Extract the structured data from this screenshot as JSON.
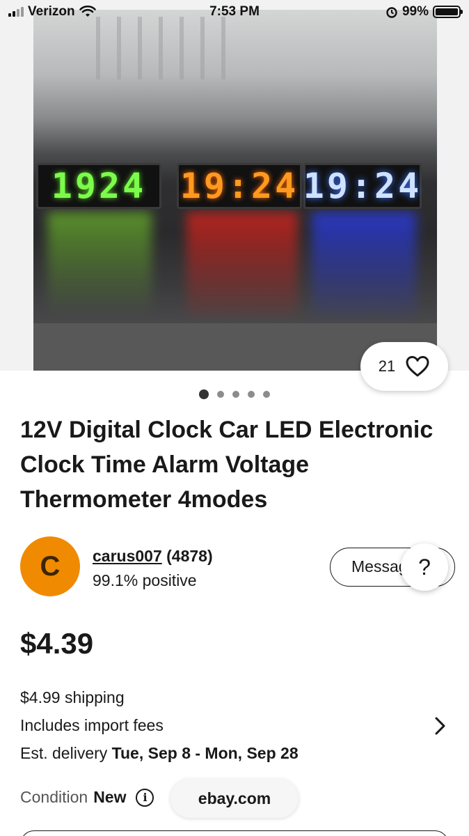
{
  "status_bar": {
    "carrier": "Verizon",
    "time": "7:53 PM",
    "battery": "99%"
  },
  "hero": {
    "clock_displays": [
      "1924",
      "19:24",
      "19:24"
    ],
    "watch_count": "21",
    "carousel_total": 5,
    "carousel_active": 1
  },
  "listing": {
    "title": "12V Digital Clock Car LED Electronic Clock Time Alarm Voltage Thermometer 4modes"
  },
  "seller": {
    "avatar_letter": "C",
    "name": "carus007",
    "rating": "(4878)",
    "feedback": "99.1% positive",
    "message_label": "Message",
    "help_label": "?"
  },
  "price": "$4.39",
  "shipping": {
    "cost": "$4.99 shipping",
    "import_fees": "Includes import fees",
    "delivery_prefix": "Est. delivery ",
    "delivery_dates": "Tue, Sep 8 - Mon, Sep 28"
  },
  "condition": {
    "label": "Condition",
    "value": "New"
  },
  "browser": {
    "url": "ebay.com"
  },
  "colors": {
    "avatar": "#f08a00",
    "text": "#191919"
  },
  "icons": [
    "wifi-icon",
    "alarm-icon",
    "battery-icon",
    "heart-icon",
    "chevron-right-icon",
    "info-icon"
  ]
}
